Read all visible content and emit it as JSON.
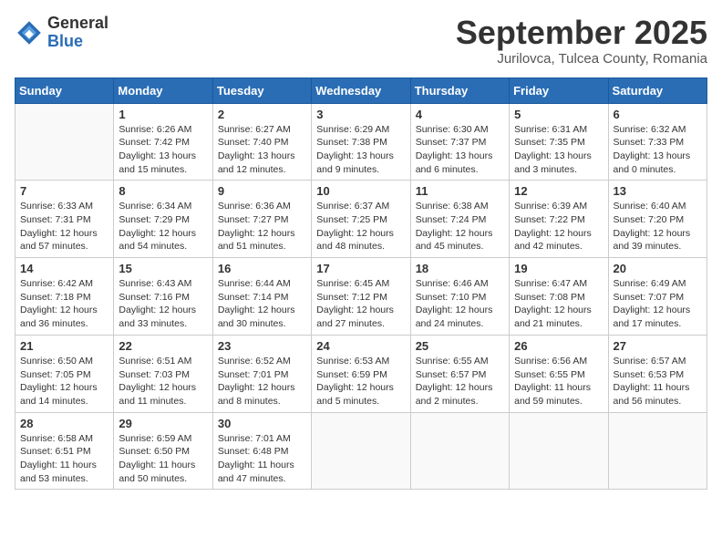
{
  "header": {
    "logo_general": "General",
    "logo_blue": "Blue",
    "month_title": "September 2025",
    "subtitle": "Jurilovca, Tulcea County, Romania"
  },
  "days_of_week": [
    "Sunday",
    "Monday",
    "Tuesday",
    "Wednesday",
    "Thursday",
    "Friday",
    "Saturday"
  ],
  "weeks": [
    [
      {
        "day": "",
        "info": ""
      },
      {
        "day": "1",
        "sunrise": "Sunrise: 6:26 AM",
        "sunset": "Sunset: 7:42 PM",
        "daylight": "Daylight: 13 hours and 15 minutes."
      },
      {
        "day": "2",
        "sunrise": "Sunrise: 6:27 AM",
        "sunset": "Sunset: 7:40 PM",
        "daylight": "Daylight: 13 hours and 12 minutes."
      },
      {
        "day": "3",
        "sunrise": "Sunrise: 6:29 AM",
        "sunset": "Sunset: 7:38 PM",
        "daylight": "Daylight: 13 hours and 9 minutes."
      },
      {
        "day": "4",
        "sunrise": "Sunrise: 6:30 AM",
        "sunset": "Sunset: 7:37 PM",
        "daylight": "Daylight: 13 hours and 6 minutes."
      },
      {
        "day": "5",
        "sunrise": "Sunrise: 6:31 AM",
        "sunset": "Sunset: 7:35 PM",
        "daylight": "Daylight: 13 hours and 3 minutes."
      },
      {
        "day": "6",
        "sunrise": "Sunrise: 6:32 AM",
        "sunset": "Sunset: 7:33 PM",
        "daylight": "Daylight: 13 hours and 0 minutes."
      }
    ],
    [
      {
        "day": "7",
        "sunrise": "Sunrise: 6:33 AM",
        "sunset": "Sunset: 7:31 PM",
        "daylight": "Daylight: 12 hours and 57 minutes."
      },
      {
        "day": "8",
        "sunrise": "Sunrise: 6:34 AM",
        "sunset": "Sunset: 7:29 PM",
        "daylight": "Daylight: 12 hours and 54 minutes."
      },
      {
        "day": "9",
        "sunrise": "Sunrise: 6:36 AM",
        "sunset": "Sunset: 7:27 PM",
        "daylight": "Daylight: 12 hours and 51 minutes."
      },
      {
        "day": "10",
        "sunrise": "Sunrise: 6:37 AM",
        "sunset": "Sunset: 7:25 PM",
        "daylight": "Daylight: 12 hours and 48 minutes."
      },
      {
        "day": "11",
        "sunrise": "Sunrise: 6:38 AM",
        "sunset": "Sunset: 7:24 PM",
        "daylight": "Daylight: 12 hours and 45 minutes."
      },
      {
        "day": "12",
        "sunrise": "Sunrise: 6:39 AM",
        "sunset": "Sunset: 7:22 PM",
        "daylight": "Daylight: 12 hours and 42 minutes."
      },
      {
        "day": "13",
        "sunrise": "Sunrise: 6:40 AM",
        "sunset": "Sunset: 7:20 PM",
        "daylight": "Daylight: 12 hours and 39 minutes."
      }
    ],
    [
      {
        "day": "14",
        "sunrise": "Sunrise: 6:42 AM",
        "sunset": "Sunset: 7:18 PM",
        "daylight": "Daylight: 12 hours and 36 minutes."
      },
      {
        "day": "15",
        "sunrise": "Sunrise: 6:43 AM",
        "sunset": "Sunset: 7:16 PM",
        "daylight": "Daylight: 12 hours and 33 minutes."
      },
      {
        "day": "16",
        "sunrise": "Sunrise: 6:44 AM",
        "sunset": "Sunset: 7:14 PM",
        "daylight": "Daylight: 12 hours and 30 minutes."
      },
      {
        "day": "17",
        "sunrise": "Sunrise: 6:45 AM",
        "sunset": "Sunset: 7:12 PM",
        "daylight": "Daylight: 12 hours and 27 minutes."
      },
      {
        "day": "18",
        "sunrise": "Sunrise: 6:46 AM",
        "sunset": "Sunset: 7:10 PM",
        "daylight": "Daylight: 12 hours and 24 minutes."
      },
      {
        "day": "19",
        "sunrise": "Sunrise: 6:47 AM",
        "sunset": "Sunset: 7:08 PM",
        "daylight": "Daylight: 12 hours and 21 minutes."
      },
      {
        "day": "20",
        "sunrise": "Sunrise: 6:49 AM",
        "sunset": "Sunset: 7:07 PM",
        "daylight": "Daylight: 12 hours and 17 minutes."
      }
    ],
    [
      {
        "day": "21",
        "sunrise": "Sunrise: 6:50 AM",
        "sunset": "Sunset: 7:05 PM",
        "daylight": "Daylight: 12 hours and 14 minutes."
      },
      {
        "day": "22",
        "sunrise": "Sunrise: 6:51 AM",
        "sunset": "Sunset: 7:03 PM",
        "daylight": "Daylight: 12 hours and 11 minutes."
      },
      {
        "day": "23",
        "sunrise": "Sunrise: 6:52 AM",
        "sunset": "Sunset: 7:01 PM",
        "daylight": "Daylight: 12 hours and 8 minutes."
      },
      {
        "day": "24",
        "sunrise": "Sunrise: 6:53 AM",
        "sunset": "Sunset: 6:59 PM",
        "daylight": "Daylight: 12 hours and 5 minutes."
      },
      {
        "day": "25",
        "sunrise": "Sunrise: 6:55 AM",
        "sunset": "Sunset: 6:57 PM",
        "daylight": "Daylight: 12 hours and 2 minutes."
      },
      {
        "day": "26",
        "sunrise": "Sunrise: 6:56 AM",
        "sunset": "Sunset: 6:55 PM",
        "daylight": "Daylight: 11 hours and 59 minutes."
      },
      {
        "day": "27",
        "sunrise": "Sunrise: 6:57 AM",
        "sunset": "Sunset: 6:53 PM",
        "daylight": "Daylight: 11 hours and 56 minutes."
      }
    ],
    [
      {
        "day": "28",
        "sunrise": "Sunrise: 6:58 AM",
        "sunset": "Sunset: 6:51 PM",
        "daylight": "Daylight: 11 hours and 53 minutes."
      },
      {
        "day": "29",
        "sunrise": "Sunrise: 6:59 AM",
        "sunset": "Sunset: 6:50 PM",
        "daylight": "Daylight: 11 hours and 50 minutes."
      },
      {
        "day": "30",
        "sunrise": "Sunrise: 7:01 AM",
        "sunset": "Sunset: 6:48 PM",
        "daylight": "Daylight: 11 hours and 47 minutes."
      },
      {
        "day": "",
        "info": ""
      },
      {
        "day": "",
        "info": ""
      },
      {
        "day": "",
        "info": ""
      },
      {
        "day": "",
        "info": ""
      }
    ]
  ]
}
